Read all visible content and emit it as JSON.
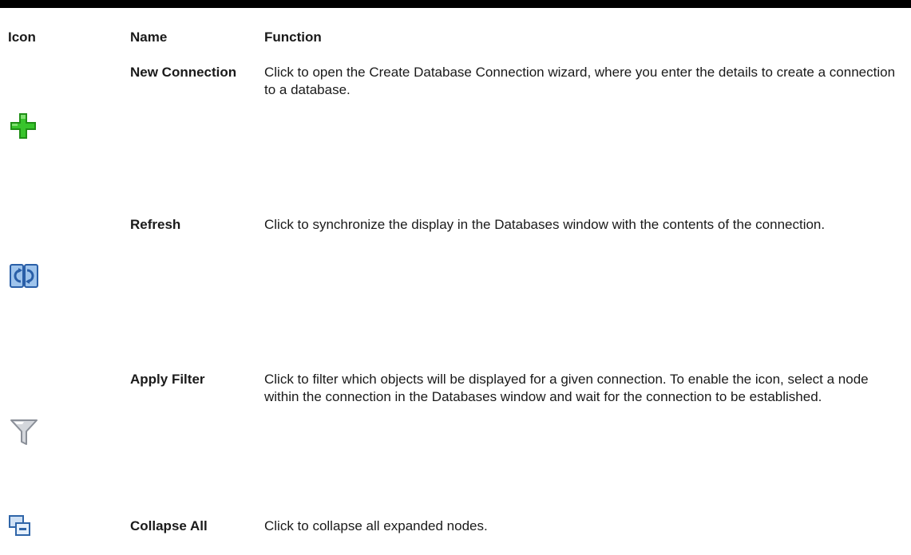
{
  "table": {
    "headers": {
      "icon": "Icon",
      "name": "Name",
      "function": "Function"
    },
    "rows": [
      {
        "icon": "plus-icon",
        "name": "New Connection",
        "function": "Click to open the Create Database Connection wizard, where you enter the details to create a connection to a database."
      },
      {
        "icon": "refresh-icon",
        "name": "Refresh",
        "function": "Click to synchronize the display in the Databases window with the contents of the connection."
      },
      {
        "icon": "filter-icon",
        "name": "Apply Filter",
        "function": "Click to filter which objects will be displayed for a given connection. To enable the icon, select a node within the connection in the Databases window and wait for the connection to be established."
      },
      {
        "icon": "collapse-all-icon",
        "name": "Collapse All",
        "function": "Click to collapse all expanded nodes."
      }
    ]
  },
  "colors": {
    "plus_green": "#22a61a",
    "refresh_blue": "#3a7fd0",
    "filter_gray": "#b8bcc4",
    "collapse_blue": "#4a86c8"
  }
}
